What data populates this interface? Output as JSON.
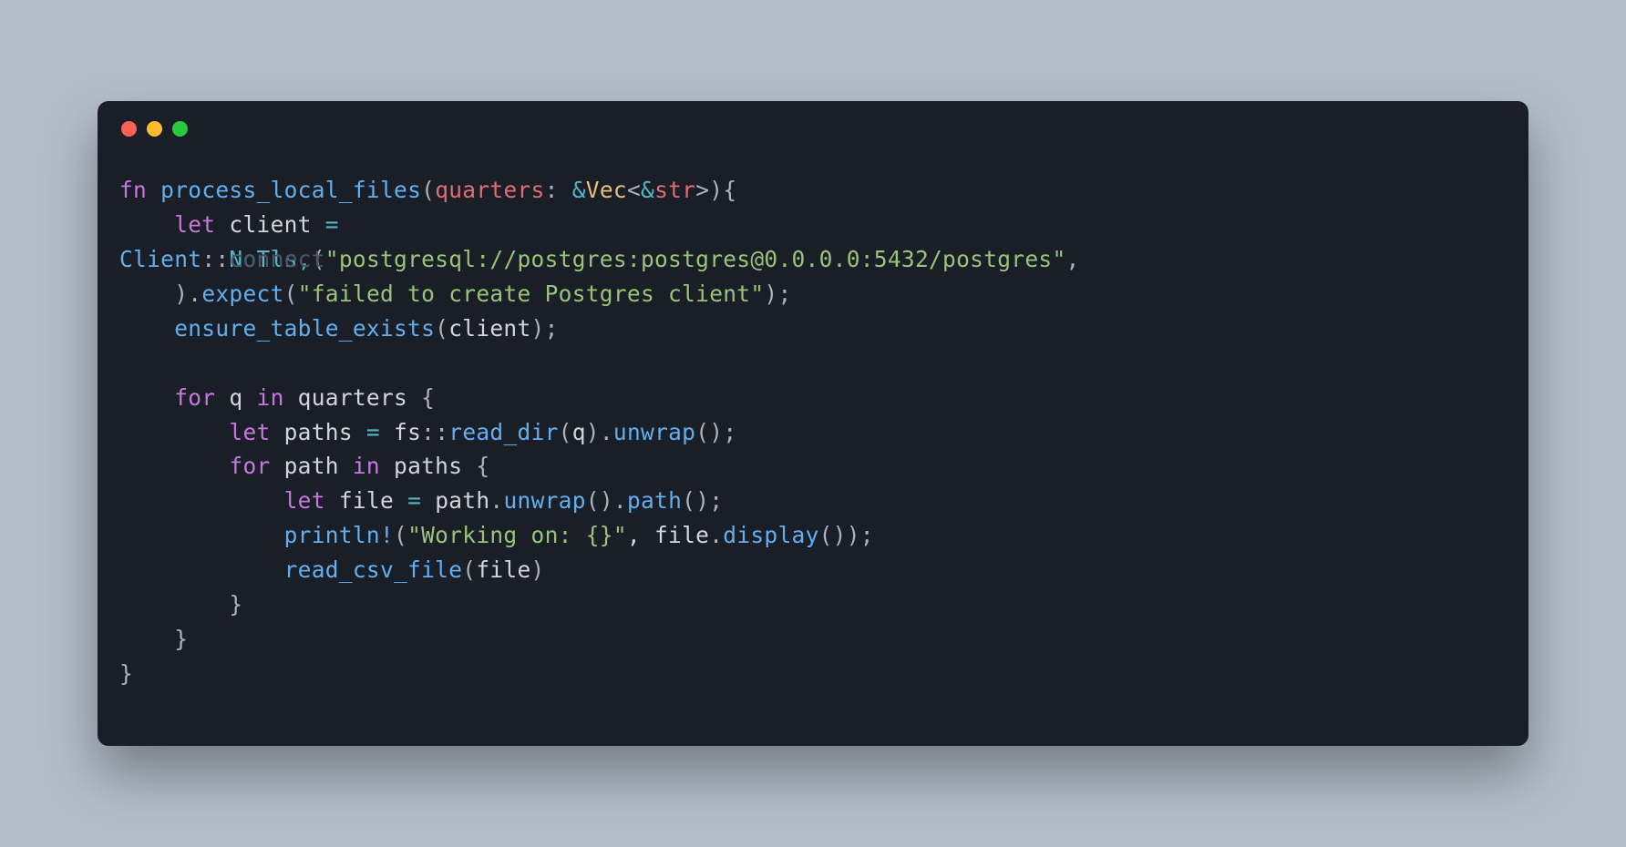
{
  "colors": {
    "bg": "#b4bec8",
    "terminal": "#1a1e27",
    "close": "#ff5f56",
    "minimize": "#ffbd2e",
    "maximize": "#27c93f"
  },
  "code": {
    "l1_fn": "fn",
    "l1_name": "process_local_files",
    "l1_paren_open": "(",
    "l1_param": "quarters",
    "l1_colon": ": ",
    "l1_ref": "&",
    "l1_vec": "Vec",
    "l1_lt": "<",
    "l1_ref2": "&",
    "l1_str": "str",
    "l1_gt": ">",
    "l1_paren_close": ")",
    "l1_brace": "{",
    "l2_indent": "    ",
    "l2_let": "let",
    "l2_sp": " ",
    "l2_var": "client",
    "l2_eq": " =",
    "l3_client": "Client",
    "l3_dcolon": "::",
    "l3_overlap": "NoTls,",
    "l3_connect": "connect",
    "l3_paren": "(",
    "l3_string": "\"postgresql://postgres:postgres@0.0.0.0:5432/postgres\"",
    "l3_comma": ",",
    "l4_indent": "    ",
    "l4_paren": ")",
    "l4_dot": ".",
    "l4_expect": "expect",
    "l4_paren2": "(",
    "l4_string": "\"failed to create Postgres client\"",
    "l4_close": ");",
    "l5_indent": "    ",
    "l5_fn": "ensure_table_exists",
    "l5_paren": "(",
    "l5_arg": "client",
    "l5_close": ");",
    "l6_blank": "",
    "l7_indent": "    ",
    "l7_for": "for",
    "l7_var": " q ",
    "l7_in": "in",
    "l7_iter": " quarters ",
    "l7_brace": "{",
    "l8_indent": "        ",
    "l8_let": "let",
    "l8_var": " paths ",
    "l8_eq": "=",
    "l8_sp": " ",
    "l8_fs": "fs",
    "l8_dcolon": "::",
    "l8_readdir": "read_dir",
    "l8_paren": "(",
    "l8_arg": "q",
    "l8_close": ")",
    "l8_dot": ".",
    "l8_unwrap": "unwrap",
    "l8_end": "();",
    "l9_indent": "        ",
    "l9_for": "for",
    "l9_var": " path ",
    "l9_in": "in",
    "l9_iter": " paths ",
    "l9_brace": "{",
    "l10_indent": "            ",
    "l10_let": "let",
    "l10_var": " file ",
    "l10_eq": "=",
    "l10_sp": " path",
    "l10_dot": ".",
    "l10_unwrap": "unwrap",
    "l10_p1": "()",
    "l10_dot2": ".",
    "l10_path": "path",
    "l10_end": "();",
    "l11_indent": "            ",
    "l11_macro": "println!",
    "l11_paren": "(",
    "l11_string": "\"Working on: {}\"",
    "l11_comma": ", file",
    "l11_dot": ".",
    "l11_display": "display",
    "l11_end": "());",
    "l12_indent": "            ",
    "l12_fn": "read_csv_file",
    "l12_paren": "(",
    "l12_arg": "file",
    "l12_close": ")",
    "l13_indent": "        ",
    "l13_brace": "}",
    "l14_indent": "    ",
    "l14_brace": "}",
    "l15_brace": "}"
  }
}
